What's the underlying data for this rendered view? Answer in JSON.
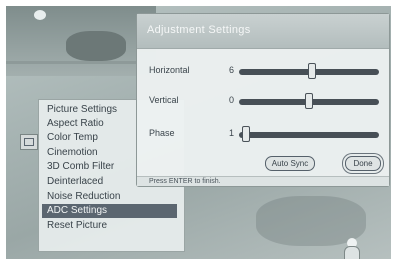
{
  "adjustment_panel": {
    "title": "Adjustment Settings",
    "rows": [
      {
        "label": "Horizontal",
        "value": "6",
        "level": 0.52
      },
      {
        "label": "Vertical",
        "value": "0",
        "level": 0.5
      },
      {
        "label": "Phase",
        "value": "1",
        "level": 0.02
      }
    ],
    "auto_sync_label": "Auto Sync",
    "done_label": "Done",
    "status_text": "Press ENTER to finish."
  },
  "main_menu": {
    "items": [
      {
        "label": "Picture Settings",
        "selected": false
      },
      {
        "label": "Aspect Ratio",
        "selected": false
      },
      {
        "label": "Color Temp",
        "selected": false
      },
      {
        "label": "Cinemotion",
        "selected": false
      },
      {
        "label": "3D Comb Filter",
        "selected": false
      },
      {
        "label": "Deinterlaced",
        "selected": false
      },
      {
        "label": "Noise Reduction",
        "selected": false
      },
      {
        "label": "ADC Settings",
        "selected": true
      },
      {
        "label": "Reset Picture",
        "selected": false
      }
    ]
  }
}
